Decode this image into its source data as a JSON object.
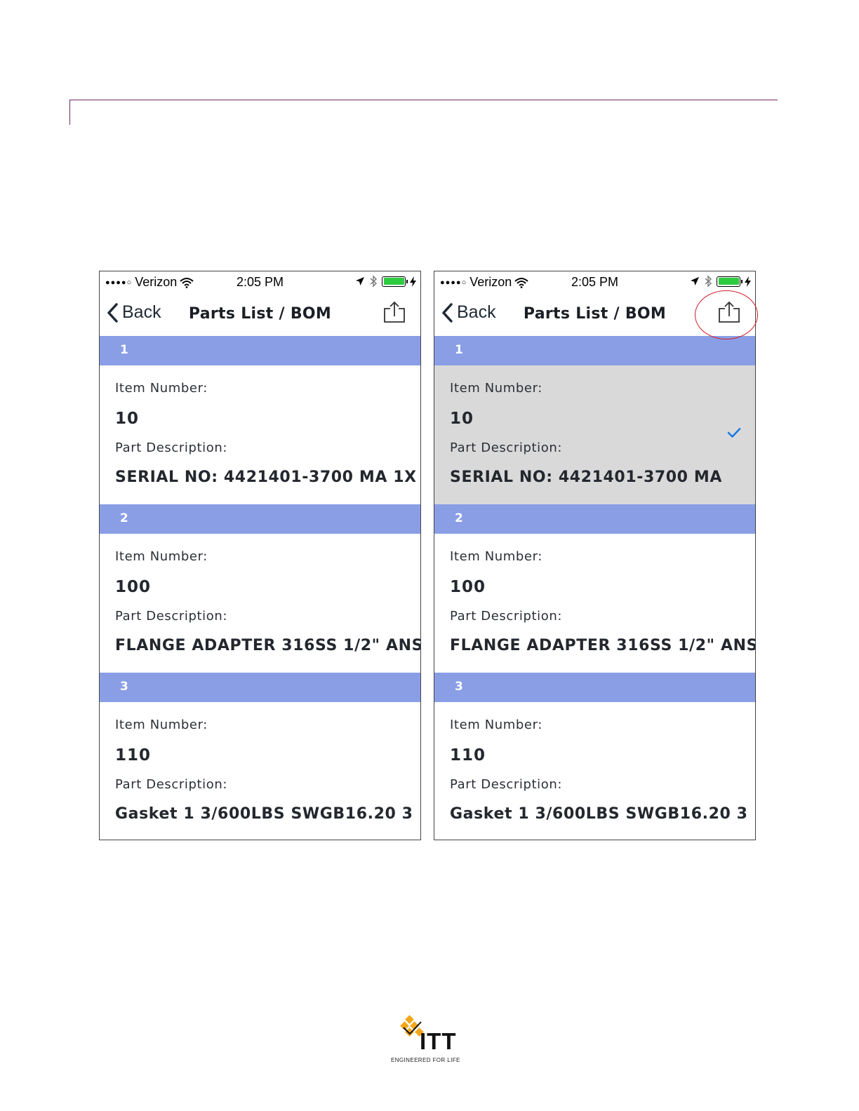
{
  "brand": {
    "name": "ITT",
    "tagline": "ENGINEERED FOR LIFE",
    "accent_color": "#6b2a6b",
    "logo_color": "#f2a71b"
  },
  "phones": [
    {
      "status": {
        "carrier": "Verizon",
        "time": "2:05 PM",
        "battery": "charging"
      },
      "nav": {
        "back_label": "Back",
        "title": "Parts List / BOM",
        "share_icon": "share-icon"
      },
      "sections": [
        {
          "header": "1",
          "item_label": "Item Number:",
          "item_value": "10",
          "desc_label": "Part Description:",
          "desc_value": "SERIAL NO: 4421401-3700 MA 1X",
          "selected": false
        },
        {
          "header": "2",
          "item_label": "Item Number:",
          "item_value": "100",
          "desc_label": "Part Description:",
          "desc_value": "FLANGE ADAPTER 316SS 1/2\" ANS",
          "selected": false
        },
        {
          "header": "3",
          "item_label": "Item Number:",
          "item_value": "110",
          "desc_label": "Part Description:",
          "desc_value": "Gasket 1 3/600LBS SWGB16.20 3",
          "selected": false
        }
      ]
    },
    {
      "status": {
        "carrier": "Verizon",
        "time": "2:05 PM",
        "battery": "charging"
      },
      "nav": {
        "back_label": "Back",
        "title": "Parts List / BOM",
        "share_icon": "share-icon",
        "share_highlight_color": "#d0202a"
      },
      "sections": [
        {
          "header": "1",
          "item_label": "Item Number:",
          "item_value": "10",
          "desc_label": "Part Description:",
          "desc_value": "SERIAL NO: 4421401-3700 MA",
          "selected": true,
          "check_color": "#1a7ae0"
        },
        {
          "header": "2",
          "item_label": "Item Number:",
          "item_value": "100",
          "desc_label": "Part Description:",
          "desc_value": "FLANGE ADAPTER 316SS 1/2\" ANS",
          "selected": false
        },
        {
          "header": "3",
          "item_label": "Item Number:",
          "item_value": "110",
          "desc_label": "Part Description:",
          "desc_value": "Gasket 1 3/600LBS SWGB16.20 3",
          "selected": false
        }
      ]
    }
  ],
  "colors": {
    "section_header_bg": "#8a9ee6",
    "selected_row_bg": "#d9d9d9"
  }
}
